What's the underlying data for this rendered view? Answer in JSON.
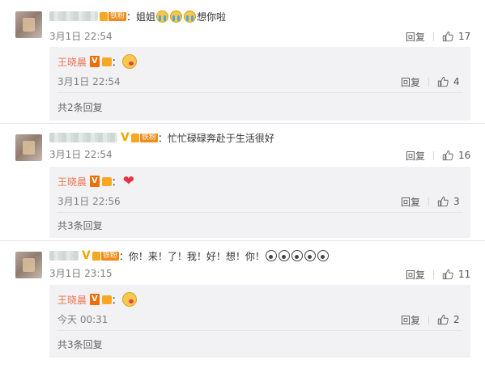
{
  "threads": [
    {
      "text_before": "：姐姐",
      "text_after": "想你啦",
      "fan_tag": "铁粉",
      "time": "3月1日 22:54",
      "reply_label": "回复",
      "likes": "17",
      "reply": {
        "name": "王晓晨",
        "vip_badge": "V",
        "time": "3月1日 22:54",
        "reply_label": "回复",
        "likes": "4"
      },
      "more": "共2条回复"
    },
    {
      "text": "：忙忙碌碌奔赴于生活很好",
      "fan_tag": "铁粉",
      "vip_badge": "V",
      "time": "3月1日 22:54",
      "reply_label": "回复",
      "likes": "16",
      "reply": {
        "name": "王晓晨",
        "vip_badge": "V",
        "time": "3月1日 22:56",
        "reply_label": "回复",
        "likes": "3"
      },
      "more": "共3条回复"
    },
    {
      "text": "：你！来！了！我！好！想！你！",
      "fan_tag": "铁粉",
      "vip_badge": "V",
      "time": "3月1日 23:15",
      "reply_label": "回复",
      "likes": "11",
      "reply": {
        "name": "王晓晨",
        "vip_badge": "V",
        "time": "今天 00:31",
        "reply_label": "回复",
        "likes": "2"
      },
      "more": "共3条回复"
    }
  ],
  "icons": {
    "like": "thumbs-up-icon",
    "crying": "crying-face-emoji",
    "wail": "wailing-face-emoji",
    "kiss": "kissing-face-emoji",
    "heart": "red-heart-emoji"
  },
  "colors": {
    "name_link": "#eb7350",
    "vip": "#f3a600",
    "fan_tag": "#f08c1a",
    "reply_bg": "#f2f2f5",
    "meta": "#808080"
  }
}
